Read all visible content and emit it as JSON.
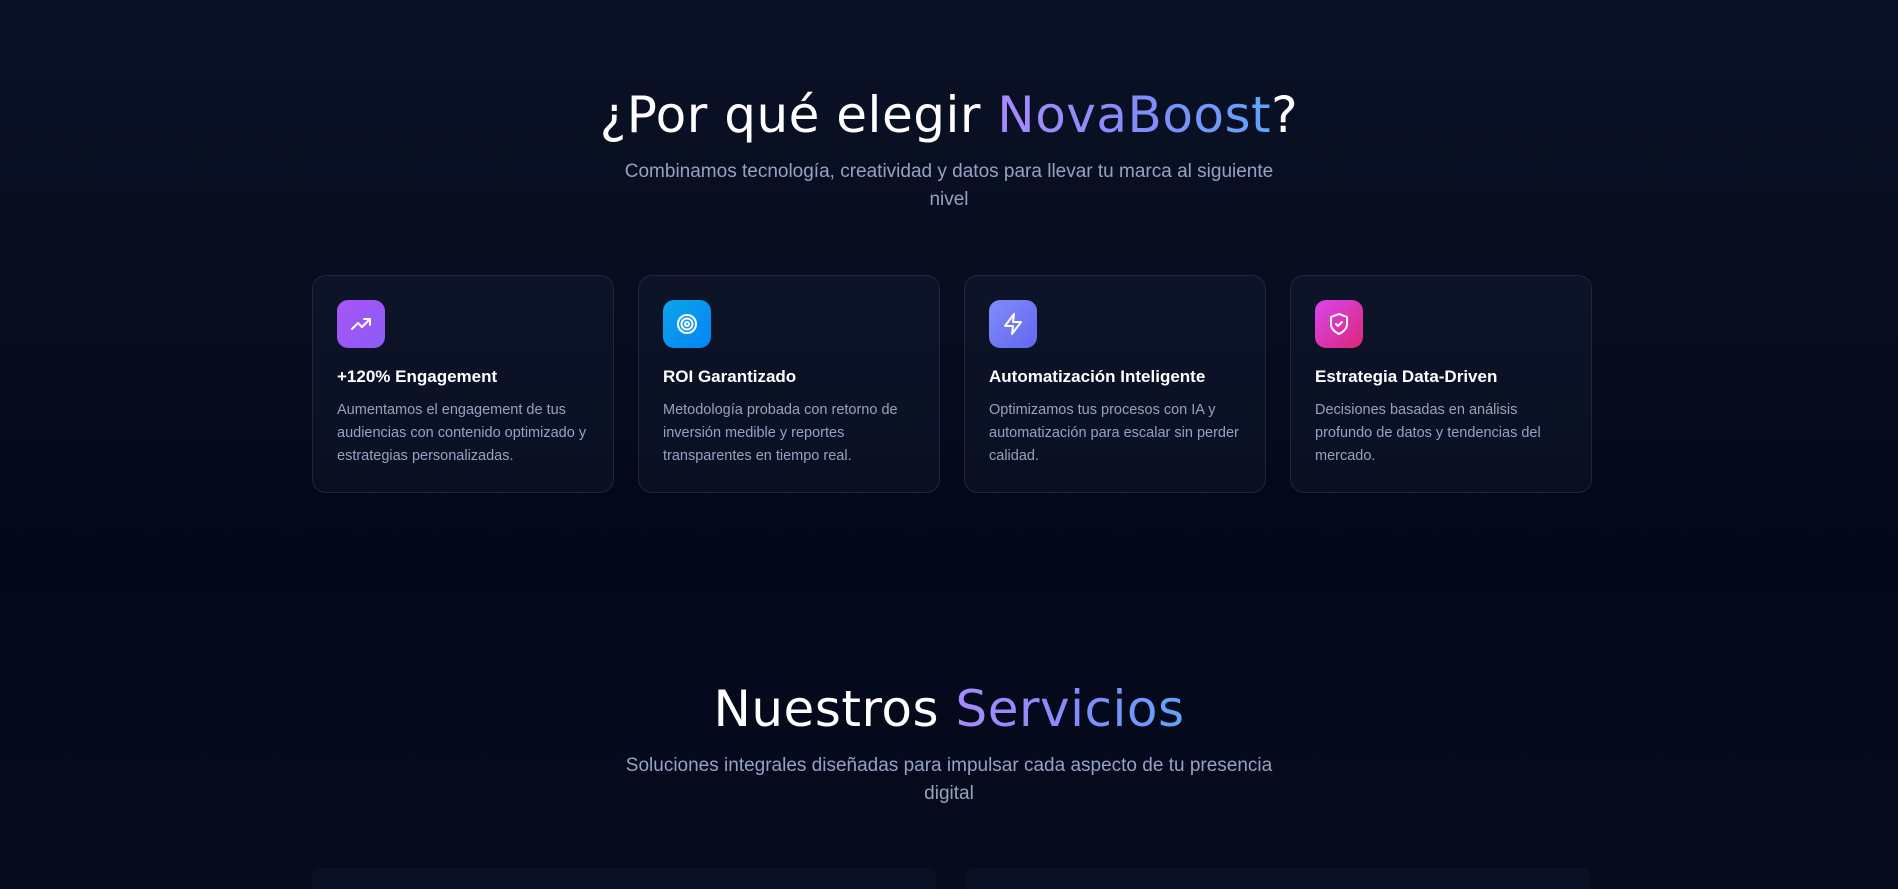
{
  "why": {
    "title_prefix": "¿Por qué elegir ",
    "title_accent": "NovaBoost",
    "title_suffix": "?",
    "subtitle": "Combinamos tecnología, creatividad y datos para llevar tu marca al siguiente nivel",
    "cards": [
      {
        "icon": "trending-up-icon",
        "title": "+120% Engagement",
        "text": "Aumentamos el engagement de tus audiencias con contenido optimizado y estrategias personalizadas."
      },
      {
        "icon": "target-icon",
        "title": "ROI Garantizado",
        "text": "Metodología probada con retorno de inversión medible y reportes transparentes en tiempo real."
      },
      {
        "icon": "lightning-icon",
        "title": "Automatización Inteligente",
        "text": "Optimizamos tus procesos con IA y automatización para escalar sin perder calidad."
      },
      {
        "icon": "shield-check-icon",
        "title": "Estrategia Data-Driven",
        "text": "Decisiones basadas en análisis profundo de datos y tendencias del mercado."
      }
    ]
  },
  "services": {
    "title_prefix": "Nuestros ",
    "title_accent": "Servicios",
    "subtitle": "Soluciones integrales diseñadas para impulsar cada aspecto de tu presencia digital"
  },
  "colors": {
    "accent_purple": "#a78bfa",
    "accent_blue": "#60a5fa",
    "background": "#060b1c"
  }
}
